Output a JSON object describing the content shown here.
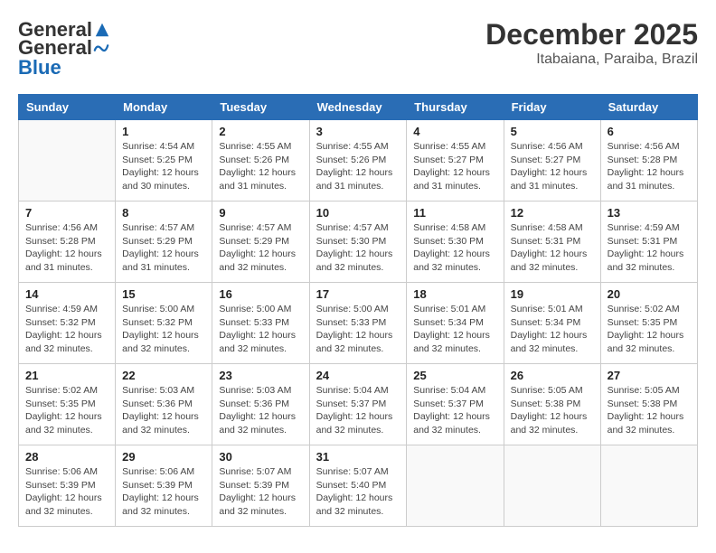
{
  "header": {
    "logo_general": "General",
    "logo_blue": "Blue",
    "month_title": "December 2025",
    "location": "Itabaiana, Paraiba, Brazil"
  },
  "columns": [
    "Sunday",
    "Monday",
    "Tuesday",
    "Wednesday",
    "Thursday",
    "Friday",
    "Saturday"
  ],
  "weeks": [
    [
      {
        "day": "",
        "info": ""
      },
      {
        "day": "1",
        "info": "Sunrise: 4:54 AM\nSunset: 5:25 PM\nDaylight: 12 hours\nand 30 minutes."
      },
      {
        "day": "2",
        "info": "Sunrise: 4:55 AM\nSunset: 5:26 PM\nDaylight: 12 hours\nand 31 minutes."
      },
      {
        "day": "3",
        "info": "Sunrise: 4:55 AM\nSunset: 5:26 PM\nDaylight: 12 hours\nand 31 minutes."
      },
      {
        "day": "4",
        "info": "Sunrise: 4:55 AM\nSunset: 5:27 PM\nDaylight: 12 hours\nand 31 minutes."
      },
      {
        "day": "5",
        "info": "Sunrise: 4:56 AM\nSunset: 5:27 PM\nDaylight: 12 hours\nand 31 minutes."
      },
      {
        "day": "6",
        "info": "Sunrise: 4:56 AM\nSunset: 5:28 PM\nDaylight: 12 hours\nand 31 minutes."
      }
    ],
    [
      {
        "day": "7",
        "info": "Sunrise: 4:56 AM\nSunset: 5:28 PM\nDaylight: 12 hours\nand 31 minutes."
      },
      {
        "day": "8",
        "info": "Sunrise: 4:57 AM\nSunset: 5:29 PM\nDaylight: 12 hours\nand 31 minutes."
      },
      {
        "day": "9",
        "info": "Sunrise: 4:57 AM\nSunset: 5:29 PM\nDaylight: 12 hours\nand 32 minutes."
      },
      {
        "day": "10",
        "info": "Sunrise: 4:57 AM\nSunset: 5:30 PM\nDaylight: 12 hours\nand 32 minutes."
      },
      {
        "day": "11",
        "info": "Sunrise: 4:58 AM\nSunset: 5:30 PM\nDaylight: 12 hours\nand 32 minutes."
      },
      {
        "day": "12",
        "info": "Sunrise: 4:58 AM\nSunset: 5:31 PM\nDaylight: 12 hours\nand 32 minutes."
      },
      {
        "day": "13",
        "info": "Sunrise: 4:59 AM\nSunset: 5:31 PM\nDaylight: 12 hours\nand 32 minutes."
      }
    ],
    [
      {
        "day": "14",
        "info": "Sunrise: 4:59 AM\nSunset: 5:32 PM\nDaylight: 12 hours\nand 32 minutes."
      },
      {
        "day": "15",
        "info": "Sunrise: 5:00 AM\nSunset: 5:32 PM\nDaylight: 12 hours\nand 32 minutes."
      },
      {
        "day": "16",
        "info": "Sunrise: 5:00 AM\nSunset: 5:33 PM\nDaylight: 12 hours\nand 32 minutes."
      },
      {
        "day": "17",
        "info": "Sunrise: 5:00 AM\nSunset: 5:33 PM\nDaylight: 12 hours\nand 32 minutes."
      },
      {
        "day": "18",
        "info": "Sunrise: 5:01 AM\nSunset: 5:34 PM\nDaylight: 12 hours\nand 32 minutes."
      },
      {
        "day": "19",
        "info": "Sunrise: 5:01 AM\nSunset: 5:34 PM\nDaylight: 12 hours\nand 32 minutes."
      },
      {
        "day": "20",
        "info": "Sunrise: 5:02 AM\nSunset: 5:35 PM\nDaylight: 12 hours\nand 32 minutes."
      }
    ],
    [
      {
        "day": "21",
        "info": "Sunrise: 5:02 AM\nSunset: 5:35 PM\nDaylight: 12 hours\nand 32 minutes."
      },
      {
        "day": "22",
        "info": "Sunrise: 5:03 AM\nSunset: 5:36 PM\nDaylight: 12 hours\nand 32 minutes."
      },
      {
        "day": "23",
        "info": "Sunrise: 5:03 AM\nSunset: 5:36 PM\nDaylight: 12 hours\nand 32 minutes."
      },
      {
        "day": "24",
        "info": "Sunrise: 5:04 AM\nSunset: 5:37 PM\nDaylight: 12 hours\nand 32 minutes."
      },
      {
        "day": "25",
        "info": "Sunrise: 5:04 AM\nSunset: 5:37 PM\nDaylight: 12 hours\nand 32 minutes."
      },
      {
        "day": "26",
        "info": "Sunrise: 5:05 AM\nSunset: 5:38 PM\nDaylight: 12 hours\nand 32 minutes."
      },
      {
        "day": "27",
        "info": "Sunrise: 5:05 AM\nSunset: 5:38 PM\nDaylight: 12 hours\nand 32 minutes."
      }
    ],
    [
      {
        "day": "28",
        "info": "Sunrise: 5:06 AM\nSunset: 5:39 PM\nDaylight: 12 hours\nand 32 minutes."
      },
      {
        "day": "29",
        "info": "Sunrise: 5:06 AM\nSunset: 5:39 PM\nDaylight: 12 hours\nand 32 minutes."
      },
      {
        "day": "30",
        "info": "Sunrise: 5:07 AM\nSunset: 5:39 PM\nDaylight: 12 hours\nand 32 minutes."
      },
      {
        "day": "31",
        "info": "Sunrise: 5:07 AM\nSunset: 5:40 PM\nDaylight: 12 hours\nand 32 minutes."
      },
      {
        "day": "",
        "info": ""
      },
      {
        "day": "",
        "info": ""
      },
      {
        "day": "",
        "info": ""
      }
    ]
  ]
}
